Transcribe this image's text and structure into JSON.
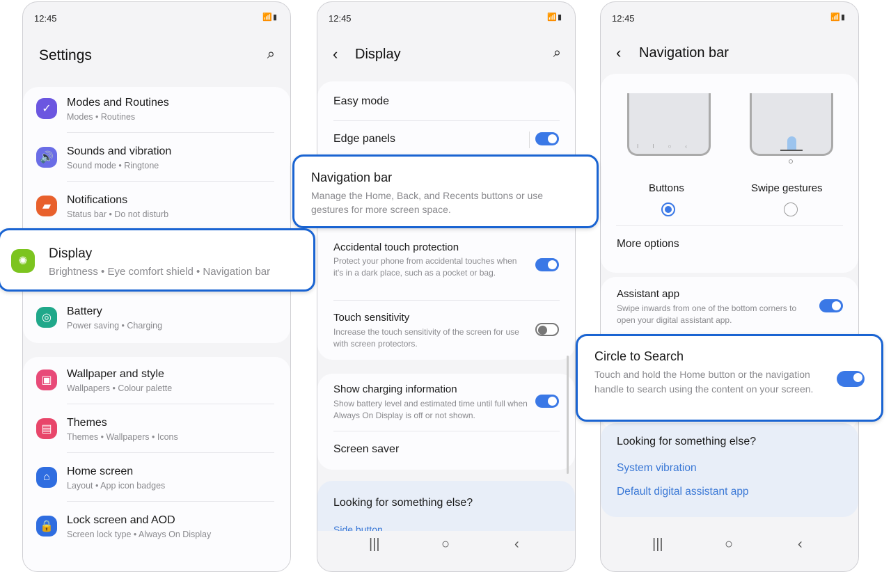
{
  "status_time": "12:45",
  "status_icons": "wifi-icon signal-icon battery-icon",
  "colors": {
    "accent": "#3a78e6",
    "highlight_border": "#1a64d2"
  },
  "settings": {
    "title": "Settings",
    "items": [
      {
        "label": "Modes and Routines",
        "sub": "Modes • Routines",
        "icon": "modes-icon",
        "color": "#6b56e0"
      },
      {
        "label": "Sounds and vibration",
        "sub": "Sound mode • Ringtone",
        "icon": "volume-icon",
        "color": "#6a6de6"
      },
      {
        "label": "Notifications",
        "sub": "Status bar • Do not disturb",
        "icon": "notification-icon",
        "color": "#e8602c"
      },
      {
        "label": "Display",
        "sub": "Brightness • Eye comfort shield • Navigation bar",
        "icon": "brightness-icon",
        "color": "#7cc41f"
      },
      {
        "label": "Battery",
        "sub": "Power saving • Charging",
        "icon": "battery-icon",
        "color": "#20a88a"
      },
      {
        "label": "Wallpaper and style",
        "sub": "Wallpapers • Colour palette",
        "icon": "wallpaper-icon",
        "color": "#e84a78"
      },
      {
        "label": "Themes",
        "sub": "Themes • Wallpapers • Icons",
        "icon": "themes-icon",
        "color": "#e8466a"
      },
      {
        "label": "Home screen",
        "sub": "Layout • App icon badges",
        "icon": "home-icon",
        "color": "#2f6de0"
      },
      {
        "label": "Lock screen and AOD",
        "sub": "Screen lock type • Always On Display",
        "icon": "lock-icon",
        "color": "#2f6de0"
      }
    ]
  },
  "display": {
    "title": "Display",
    "easy_mode": "Easy mode",
    "edge_panels": "Edge panels",
    "nav_bar": {
      "label": "Navigation bar",
      "desc": "Manage the Home, Back, and Recents buttons or use gestures for more screen space."
    },
    "accidental": {
      "label": "Accidental touch protection",
      "desc": "Protect your phone from accidental touches when it's in a dark place, such as a pocket or bag.",
      "on": true
    },
    "touch": {
      "label": "Touch sensitivity",
      "desc": "Increase the touch sensitivity of the screen for use with screen protectors.",
      "on": false
    },
    "charging": {
      "label": "Show charging information",
      "desc": "Show battery level and estimated time until full when Always On Display is off or not shown.",
      "on": true
    },
    "screen_saver": "Screen saver",
    "looking": "Looking for something else?",
    "side_button": "Side button"
  },
  "navigation": {
    "title": "Navigation bar",
    "buttons": "Buttons",
    "swipe": "Swipe gestures",
    "selected": "Buttons",
    "more_options": "More options",
    "assistant": {
      "label": "Assistant app",
      "desc": "Swipe inwards from one of the bottom corners to open your digital assistant app.",
      "on": true
    },
    "circle": {
      "label": "Circle to Search",
      "desc": "Touch and hold the Home button or the navigation handle to search using the content on your screen.",
      "on": true
    },
    "looking": "Looking for something else?",
    "links": [
      "System vibration",
      "Default digital assistant app"
    ]
  },
  "nav_keys": {
    "recents": "|||",
    "home": "○",
    "back": "‹"
  }
}
